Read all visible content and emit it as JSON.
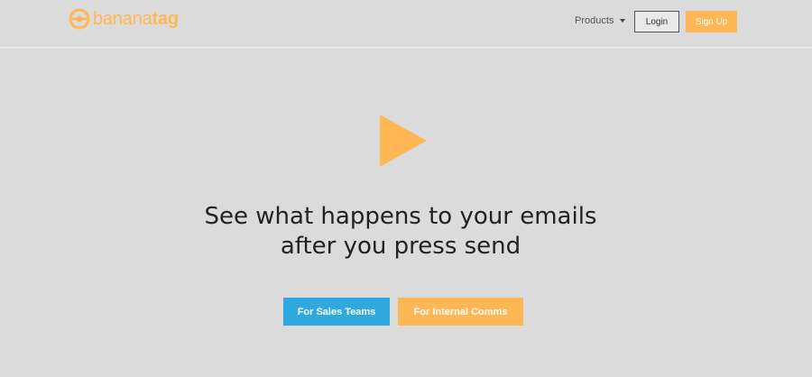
{
  "brand": {
    "name_part1": "banana",
    "name_part2": "tag",
    "logo_icon": "bananatag-logo-icon",
    "color": "#ffb655"
  },
  "nav": {
    "products_label": "Products",
    "products_icon": "caret-down-icon",
    "login_label": "Login",
    "signup_label": "Sign Up"
  },
  "hero": {
    "play_icon": "play-icon",
    "headline_line1": "See what happens to your emails",
    "headline_line2": "after you press send",
    "cta_sales_label": "For Sales Teams",
    "cta_comms_label": "For Internal Comms"
  },
  "colors": {
    "background": "#dbdbdb",
    "accent_orange": "#ffb655",
    "accent_blue": "#2fa8e0",
    "text_dark": "#222222"
  }
}
